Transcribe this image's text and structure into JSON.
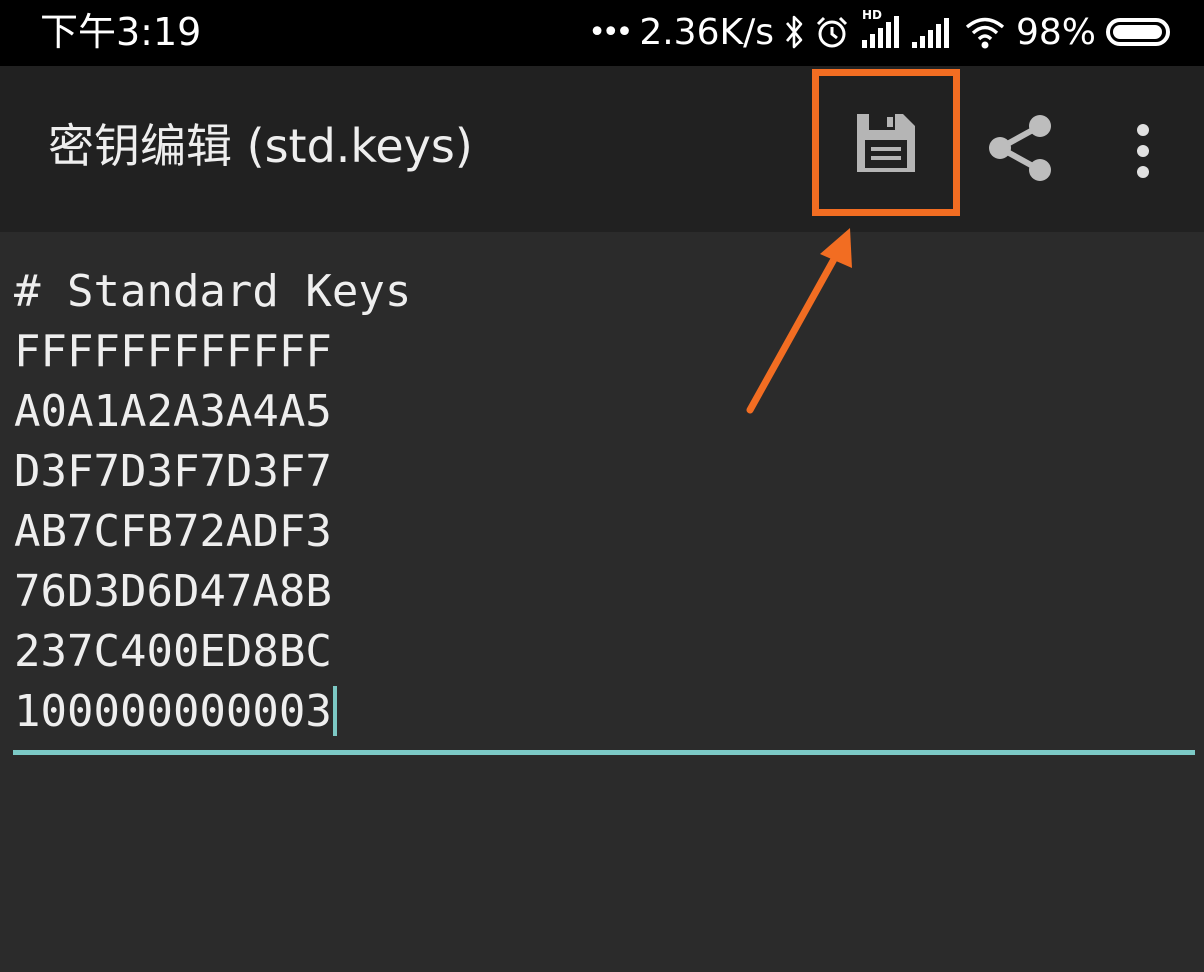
{
  "status_bar": {
    "time": "下午3:19",
    "dots": "•••",
    "network_speed": "2.36K/s",
    "signal_label": "HD",
    "battery_percent": "98%",
    "battery_level": 0.98,
    "icons": [
      "bluetooth-icon",
      "alarm-icon",
      "signal-hd-icon",
      "signal-icon",
      "wifi-icon",
      "battery-icon"
    ]
  },
  "app_bar": {
    "title": "密钥编辑 (std.keys)",
    "actions": [
      "save-icon",
      "share-icon",
      "more-vert-icon"
    ]
  },
  "editor": {
    "lines": [
      "# Standard Keys",
      "FFFFFFFFFFFF",
      "A0A1A2A3A4A5",
      "D3F7D3F7D3F7",
      "AB7CFB72ADF3",
      "76D3D6D47A8B",
      "237C400ED8BC",
      "100000000003"
    ]
  },
  "colors": {
    "highlight": "#f26d22",
    "accent": "#7ccac6",
    "app_bar_bg": "#212121",
    "editor_bg": "#2b2b2b"
  }
}
